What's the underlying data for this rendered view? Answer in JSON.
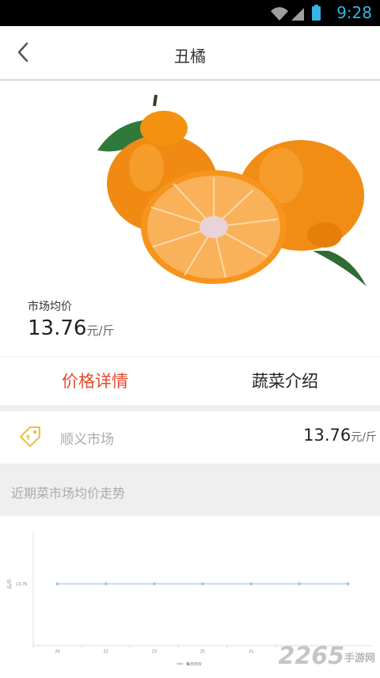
{
  "statusbar": {
    "time": "9:28"
  },
  "navbar": {
    "title": "丑橘"
  },
  "hero": {
    "price_label": "市场均价",
    "price_value": "13.76",
    "price_unit": "元/斤"
  },
  "tabs": [
    {
      "label": "价格详情",
      "active": true
    },
    {
      "label": "蔬菜介绍",
      "active": false
    }
  ],
  "market": {
    "name": "顺义市场",
    "value": "13.76",
    "unit": "元/斤"
  },
  "trend": {
    "title": "近期菜市场均价走势"
  },
  "watermark": {
    "text": "2265",
    "sub": "手游网"
  },
  "colors": {
    "accent": "#e8492d",
    "line": "#a9c7e6",
    "tag": "#e8c14a"
  },
  "chart_data": {
    "type": "line",
    "x": [
      "20",
      "22",
      "23",
      "25",
      "21",
      "",
      ""
    ],
    "series": [
      {
        "name": "每日均价",
        "values": [
          13.76,
          13.76,
          13.76,
          13.76,
          13.76,
          13.76,
          13.76
        ]
      }
    ],
    "y_ticks": [
      "13.76"
    ],
    "ylabel": "元/斤",
    "legend": "bottom"
  }
}
